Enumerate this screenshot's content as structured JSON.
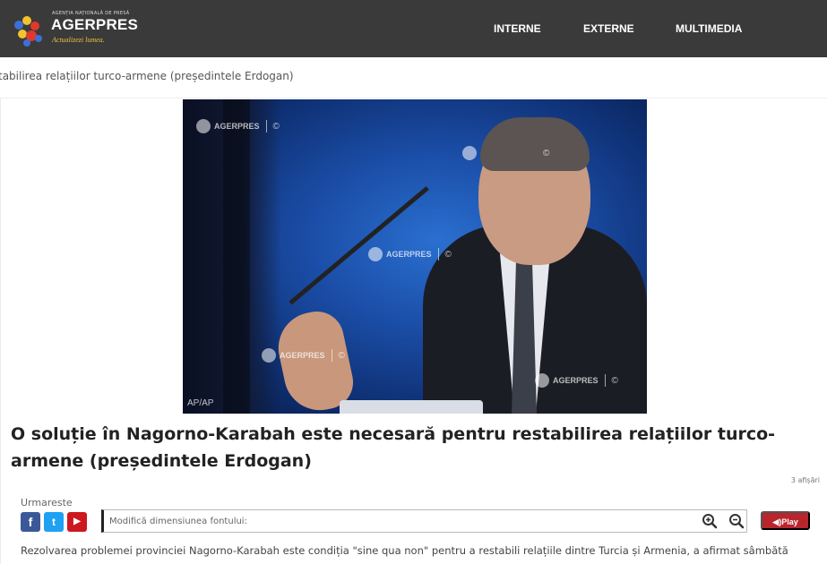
{
  "header": {
    "logo": {
      "small_text": "AGENȚIA NAȚIONALĂ DE PRESĂ",
      "name": "AGERPRES",
      "tagline": "Actualizezi lumea.",
      "icon": "agerpres-logo-icon"
    },
    "nav": [
      {
        "label": "INTERNE"
      },
      {
        "label": "EXTERNE"
      },
      {
        "label": "MULTIMEDIA"
      }
    ]
  },
  "breadcrumb": {
    "text": "tabilirea relațiilor turco-armene (președintele Erdogan)"
  },
  "photo": {
    "watermark": "AGERPRES",
    "copyright_symbol": "©",
    "credit": "AP/AP"
  },
  "article": {
    "title": "O soluție în Nagorno-Karabah este necesară pentru restabilirea relațiilor turco-armene (președintele Erdogan)",
    "views": "3 afișări",
    "lead": "Rezolvarea problemei provinciei Nagorno-Karabah este condiția \"sine qua non\" pentru a restabili relațiile dintre Turcia și Armenia, a afirmat sâmbătă"
  },
  "toolbar": {
    "follow_label": "Urmareste",
    "social": [
      {
        "name": "facebook-icon",
        "glyph": "f",
        "color": "#3b5998"
      },
      {
        "name": "twitter-icon",
        "glyph": "t",
        "color": "#1da1f2"
      },
      {
        "name": "youtube-icon",
        "glyph": "▶",
        "color": "#cc181e"
      }
    ],
    "font_resize_placeholder": "Modifică dimensiunea fontului:",
    "zoom_in_icon": "zoom-in-icon",
    "zoom_out_icon": "zoom-out-icon",
    "play_label": "◀)Play",
    "play_color": "#b8252c"
  },
  "colors": {
    "header_bg": "#3a3a3a",
    "accent_red": "#b8252c"
  }
}
